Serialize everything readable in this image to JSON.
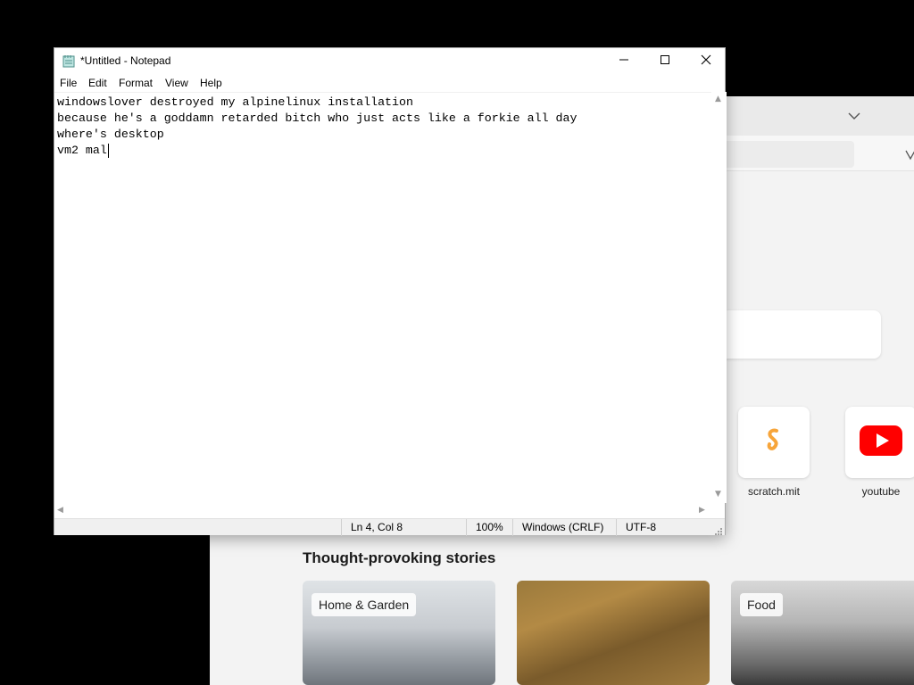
{
  "notepad": {
    "title": "*Untitled - Notepad",
    "menu": [
      "File",
      "Edit",
      "Format",
      "View",
      "Help"
    ],
    "lines": [
      "windowslover destroyed my alpinelinux installation",
      "because he's a goddamn retarded bitch who just acts like a forkie all day",
      "where's desktop",
      "vm2 mal"
    ],
    "status": {
      "position": "Ln 4, Col 8",
      "zoom": "100%",
      "line_ending": "Windows (CRLF)",
      "encoding": "UTF-8"
    }
  },
  "browser": {
    "tiles": [
      {
        "label": "scratch.mit",
        "icon": "scratch-icon"
      },
      {
        "label": "youtube",
        "icon": "youtube-icon"
      }
    ],
    "stories_heading": "Thought-provoking stories",
    "stories": [
      {
        "category": "Home & Garden"
      },
      {
        "category": ""
      },
      {
        "category": "Food"
      }
    ]
  },
  "colors": {
    "youtube_red": "#ff0000",
    "scratch_orange": "#f7a53a",
    "desktop_background": "#000000"
  }
}
